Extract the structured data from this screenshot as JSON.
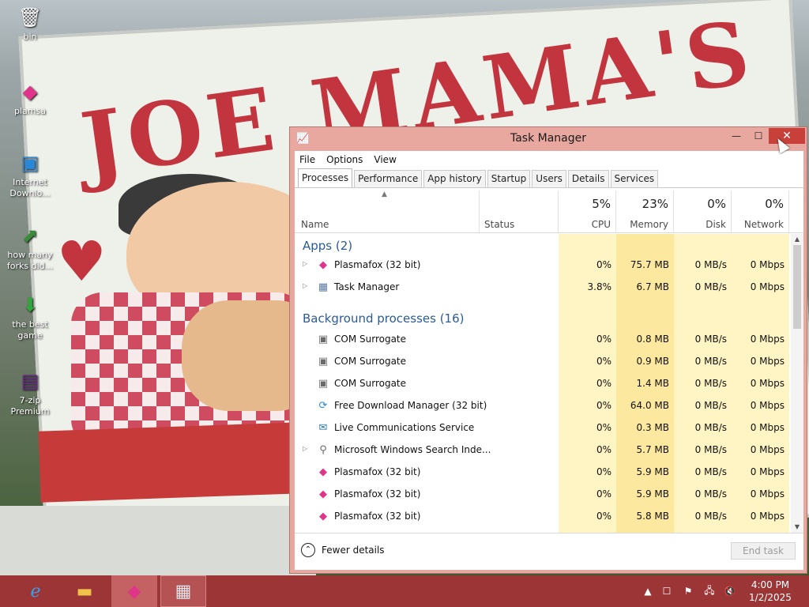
{
  "desktop": {
    "wallpaper_text": "JOE MAMA'S",
    "icons": [
      {
        "label": "bin",
        "icon": "recycle-bin-icon"
      },
      {
        "label": "plamsa",
        "icon": "plasmafox-icon"
      },
      {
        "label": "Internet Downlo...",
        "icon": "download-manager-icon"
      },
      {
        "label": "how many forks did...",
        "icon": "shortcut-icon"
      },
      {
        "label": "the best game",
        "icon": "game-icon"
      },
      {
        "label": "7-zip Premium",
        "icon": "archive-icon"
      }
    ]
  },
  "window": {
    "title": "Task Manager",
    "minimize_glyph": "—",
    "maximize_glyph": "☐",
    "close_glyph": "✕"
  },
  "menu": [
    "File",
    "Options",
    "View"
  ],
  "tabs": [
    "Processes",
    "Performance",
    "App history",
    "Startup",
    "Users",
    "Details",
    "Services"
  ],
  "active_tab": "Processes",
  "columns": {
    "name": "Name",
    "status": "Status",
    "cpu": {
      "pct": "5%",
      "label": "CPU"
    },
    "memory": {
      "pct": "23%",
      "label": "Memory"
    },
    "disk": {
      "pct": "0%",
      "label": "Disk"
    },
    "network": {
      "pct": "0%",
      "label": "Network"
    }
  },
  "groups": {
    "apps": "Apps (2)",
    "background": "Background processes (16)"
  },
  "apps": [
    {
      "name": "Plasmafox (32 bit)",
      "icon": "plasmafox-icon",
      "expandable": true,
      "cpu": "0%",
      "memory": "75.7 MB",
      "disk": "0 MB/s",
      "network": "0 Mbps"
    },
    {
      "name": "Task Manager",
      "icon": "task-manager-icon",
      "expandable": true,
      "cpu": "3.8%",
      "memory": "6.7 MB",
      "disk": "0 MB/s",
      "network": "0 Mbps"
    }
  ],
  "background": [
    {
      "name": "COM Surrogate",
      "icon": "window-icon",
      "expandable": false,
      "cpu": "0%",
      "memory": "0.8 MB",
      "disk": "0 MB/s",
      "network": "0 Mbps"
    },
    {
      "name": "COM Surrogate",
      "icon": "window-icon",
      "expandable": false,
      "cpu": "0%",
      "memory": "0.9 MB",
      "disk": "0 MB/s",
      "network": "0 Mbps"
    },
    {
      "name": "COM Surrogate",
      "icon": "window-icon",
      "expandable": false,
      "cpu": "0%",
      "memory": "1.4 MB",
      "disk": "0 MB/s",
      "network": "0 Mbps"
    },
    {
      "name": "Free Download Manager (32 bit)",
      "icon": "download-manager-icon",
      "expandable": false,
      "cpu": "0%",
      "memory": "64.0 MB",
      "disk": "0 MB/s",
      "network": "0 Mbps"
    },
    {
      "name": "Live Communications Service",
      "icon": "mail-icon",
      "expandable": false,
      "cpu": "0%",
      "memory": "0.3 MB",
      "disk": "0 MB/s",
      "network": "0 Mbps"
    },
    {
      "name": "Microsoft Windows Search Inde...",
      "icon": "search-indexer-icon",
      "expandable": true,
      "cpu": "0%",
      "memory": "5.7 MB",
      "disk": "0 MB/s",
      "network": "0 Mbps"
    },
    {
      "name": "Plasmafox (32 bit)",
      "icon": "plasmafox-icon",
      "expandable": false,
      "cpu": "0%",
      "memory": "5.9 MB",
      "disk": "0 MB/s",
      "network": "0 Mbps"
    },
    {
      "name": "Plasmafox (32 bit)",
      "icon": "plasmafox-icon",
      "expandable": false,
      "cpu": "0%",
      "memory": "5.9 MB",
      "disk": "0 MB/s",
      "network": "0 Mbps"
    },
    {
      "name": "Plasmafox (32 bit)",
      "icon": "plasmafox-icon",
      "expandable": false,
      "cpu": "0%",
      "memory": "5.8 MB",
      "disk": "0 MB/s",
      "network": "0 Mbps"
    }
  ],
  "footer": {
    "fewer_details": "Fewer details",
    "end_task": "End task"
  },
  "taskbar": {
    "items": [
      "internet-explorer-icon",
      "file-explorer-icon",
      "plasmafox-icon",
      "task-manager-icon"
    ],
    "clock_time": "4:00 PM",
    "clock_date": "1/2/2025"
  },
  "colors": {
    "accent_taskbar": "#9c3536",
    "window_frame": "#e8a8a0",
    "close_button": "#c7403a",
    "group_heading": "#2a5b94",
    "heat_light": "#fff4c4",
    "heat_medium": "#fde8a0"
  }
}
